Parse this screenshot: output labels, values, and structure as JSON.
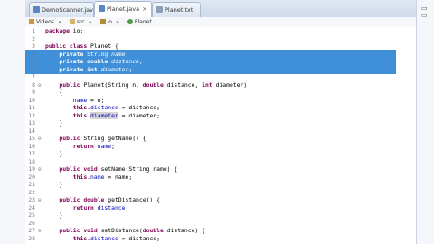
{
  "tabs": [
    {
      "label": "DemoScanner.java",
      "active": false
    },
    {
      "label": "Planet.java",
      "active": true
    },
    {
      "label": "Planet.txt",
      "active": false
    }
  ],
  "window_controls": "▭ ▭",
  "breadcrumb": [
    "Videos",
    "src",
    "io",
    "Planet"
  ],
  "code_lines": [
    {
      "n": "1",
      "segs": [
        {
          "t": "package io;",
          "c": "kw-first"
        }
      ]
    },
    {
      "n": "2",
      "segs": [
        {
          "t": "",
          "c": ""
        }
      ]
    },
    {
      "n": "3",
      "segs": [
        {
          "t": "public class ",
          "c": "kw"
        },
        {
          "t": "Planet {",
          "c": ""
        }
      ]
    },
    {
      "n": "4",
      "sel": true,
      "segs": [
        {
          "t": "    ",
          "c": ""
        },
        {
          "t": "private ",
          "c": "kw"
        },
        {
          "t": "String ",
          "c": ""
        },
        {
          "t": "name",
          "c": "fld"
        },
        {
          "t": ";",
          "c": ""
        }
      ]
    },
    {
      "n": "5",
      "sel": true,
      "segs": [
        {
          "t": "    ",
          "c": ""
        },
        {
          "t": "private double ",
          "c": "kw"
        },
        {
          "t": "distance",
          "c": "fld"
        },
        {
          "t": ";",
          "c": ""
        }
      ]
    },
    {
      "n": "6",
      "sel": true,
      "segs": [
        {
          "t": "    ",
          "c": ""
        },
        {
          "t": "private int ",
          "c": "kw"
        },
        {
          "t": "diameter",
          "c": "fld"
        },
        {
          "t": ";",
          "c": ""
        }
      ]
    },
    {
      "n": "7",
      "segs": [
        {
          "t": "",
          "c": ""
        }
      ]
    },
    {
      "n": "8⊖",
      "segs": [
        {
          "t": "    ",
          "c": ""
        },
        {
          "t": "public ",
          "c": "kw"
        },
        {
          "t": "Planet(String n, ",
          "c": ""
        },
        {
          "t": "double ",
          "c": "kw"
        },
        {
          "t": "distance, ",
          "c": ""
        },
        {
          "t": "int ",
          "c": "kw"
        },
        {
          "t": "diameter)",
          "c": ""
        }
      ]
    },
    {
      "n": "9",
      "segs": [
        {
          "t": "    {",
          "c": ""
        }
      ]
    },
    {
      "n": "10",
      "segs": [
        {
          "t": "        ",
          "c": ""
        },
        {
          "t": "name",
          "c": "fldn"
        },
        {
          "t": " = n;",
          "c": ""
        }
      ]
    },
    {
      "n": "11",
      "segs": [
        {
          "t": "        ",
          "c": ""
        },
        {
          "t": "this",
          "c": "kw"
        },
        {
          "t": ".",
          "c": ""
        },
        {
          "t": "distance",
          "c": "fldn"
        },
        {
          "t": " = distance;",
          "c": ""
        }
      ]
    },
    {
      "n": "12",
      "segs": [
        {
          "t": "        ",
          "c": ""
        },
        {
          "t": "this",
          "c": "kw"
        },
        {
          "t": ".",
          "c": ""
        },
        {
          "t": "diameter",
          "c": "fldn mark"
        },
        {
          "t": " = diameter;",
          "c": ""
        }
      ]
    },
    {
      "n": "13",
      "segs": [
        {
          "t": "    }",
          "c": ""
        }
      ]
    },
    {
      "n": "14",
      "segs": [
        {
          "t": "",
          "c": ""
        }
      ]
    },
    {
      "n": "15⊖",
      "segs": [
        {
          "t": "    ",
          "c": ""
        },
        {
          "t": "public ",
          "c": "kw"
        },
        {
          "t": "String getName() {",
          "c": ""
        }
      ]
    },
    {
      "n": "16",
      "segs": [
        {
          "t": "        ",
          "c": ""
        },
        {
          "t": "return ",
          "c": "kw"
        },
        {
          "t": "name",
          "c": "fldn"
        },
        {
          "t": ";",
          "c": ""
        }
      ]
    },
    {
      "n": "17",
      "segs": [
        {
          "t": "    }",
          "c": ""
        }
      ]
    },
    {
      "n": "18",
      "segs": [
        {
          "t": "",
          "c": ""
        }
      ]
    },
    {
      "n": "19⊖",
      "segs": [
        {
          "t": "    ",
          "c": ""
        },
        {
          "t": "public void ",
          "c": "kw"
        },
        {
          "t": "setName(String name) {",
          "c": ""
        }
      ]
    },
    {
      "n": "20",
      "segs": [
        {
          "t": "        ",
          "c": ""
        },
        {
          "t": "this",
          "c": "kw"
        },
        {
          "t": ".",
          "c": ""
        },
        {
          "t": "name",
          "c": "fldn"
        },
        {
          "t": " = name;",
          "c": ""
        }
      ]
    },
    {
      "n": "21",
      "segs": [
        {
          "t": "    }",
          "c": ""
        }
      ]
    },
    {
      "n": "22",
      "segs": [
        {
          "t": "",
          "c": ""
        }
      ]
    },
    {
      "n": "23⊖",
      "segs": [
        {
          "t": "    ",
          "c": ""
        },
        {
          "t": "public double ",
          "c": "kw"
        },
        {
          "t": "getDistance() {",
          "c": ""
        }
      ]
    },
    {
      "n": "24",
      "segs": [
        {
          "t": "        ",
          "c": ""
        },
        {
          "t": "return ",
          "c": "kw"
        },
        {
          "t": "distance",
          "c": "fldn"
        },
        {
          "t": ";",
          "c": ""
        }
      ]
    },
    {
      "n": "25",
      "segs": [
        {
          "t": "    }",
          "c": ""
        }
      ]
    },
    {
      "n": "26",
      "segs": [
        {
          "t": "",
          "c": ""
        }
      ]
    },
    {
      "n": "27⊖",
      "segs": [
        {
          "t": "    ",
          "c": ""
        },
        {
          "t": "public void ",
          "c": "kw"
        },
        {
          "t": "setDistance(",
          "c": ""
        },
        {
          "t": "double ",
          "c": "kw"
        },
        {
          "t": "distance) {",
          "c": ""
        }
      ]
    },
    {
      "n": "28",
      "segs": [
        {
          "t": "        ",
          "c": ""
        },
        {
          "t": "this",
          "c": "kw"
        },
        {
          "t": ".",
          "c": ""
        },
        {
          "t": "distance",
          "c": "fldn"
        },
        {
          "t": " = distance;",
          "c": ""
        }
      ]
    }
  ],
  "colors": {
    "keyword": "#7f0055",
    "field": "#0000c0",
    "selection": "#3f8fd9"
  }
}
